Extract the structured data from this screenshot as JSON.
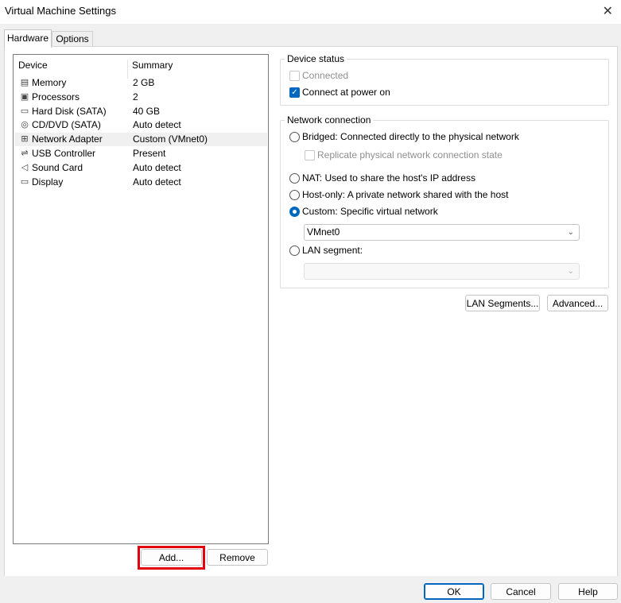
{
  "window": {
    "title": "Virtual Machine Settings",
    "close_glyph": "✕"
  },
  "tabs": [
    {
      "label": "Hardware",
      "active": true
    },
    {
      "label": "Options",
      "active": false
    }
  ],
  "device_list": {
    "col_device": "Device",
    "col_summary": "Summary",
    "rows": [
      {
        "name": "Memory",
        "summary": "2 GB",
        "icon": "memory-icon",
        "glyph": "▤"
      },
      {
        "name": "Processors",
        "summary": "2",
        "icon": "processor-icon",
        "glyph": "▣"
      },
      {
        "name": "Hard Disk (SATA)",
        "summary": "40 GB",
        "icon": "hard-disk-icon",
        "glyph": "▭"
      },
      {
        "name": "CD/DVD (SATA)",
        "summary": "Auto detect",
        "icon": "cd-dvd-icon",
        "glyph": "◎"
      },
      {
        "name": "Network Adapter",
        "summary": "Custom (VMnet0)",
        "icon": "network-adapter-icon",
        "glyph": "⊞",
        "selected": true
      },
      {
        "name": "USB Controller",
        "summary": "Present",
        "icon": "usb-icon",
        "glyph": "⇌"
      },
      {
        "name": "Sound Card",
        "summary": "Auto detect",
        "icon": "speaker-icon",
        "glyph": "◁"
      },
      {
        "name": "Display",
        "summary": "Auto detect",
        "icon": "display-icon",
        "glyph": "▭"
      }
    ]
  },
  "list_buttons": {
    "add": "Add...",
    "remove": "Remove"
  },
  "device_status": {
    "title": "Device status",
    "connected": {
      "label": "Connected",
      "checked": false,
      "disabled": true
    },
    "connect_at_power_on": {
      "label": "Connect at power on",
      "checked": true
    }
  },
  "network_connection": {
    "title": "Network connection",
    "bridged": "Bridged: Connected directly to the physical network",
    "replicate": "Replicate physical network connection state",
    "nat": "NAT: Used to share the host's IP address",
    "host_only": "Host-only: A private network shared with the host",
    "custom": "Custom: Specific virtual network",
    "selected": "custom",
    "vmnet_value": "VMnet0",
    "lan_segment": "LAN segment:",
    "lan_segment_value": ""
  },
  "side_buttons": {
    "lan_segments": "LAN Segments...",
    "advanced": "Advanced..."
  },
  "footer": {
    "ok": "OK",
    "cancel": "Cancel",
    "help": "Help"
  },
  "colors": {
    "accent": "#0067c0",
    "highlight": "#e3000f"
  }
}
